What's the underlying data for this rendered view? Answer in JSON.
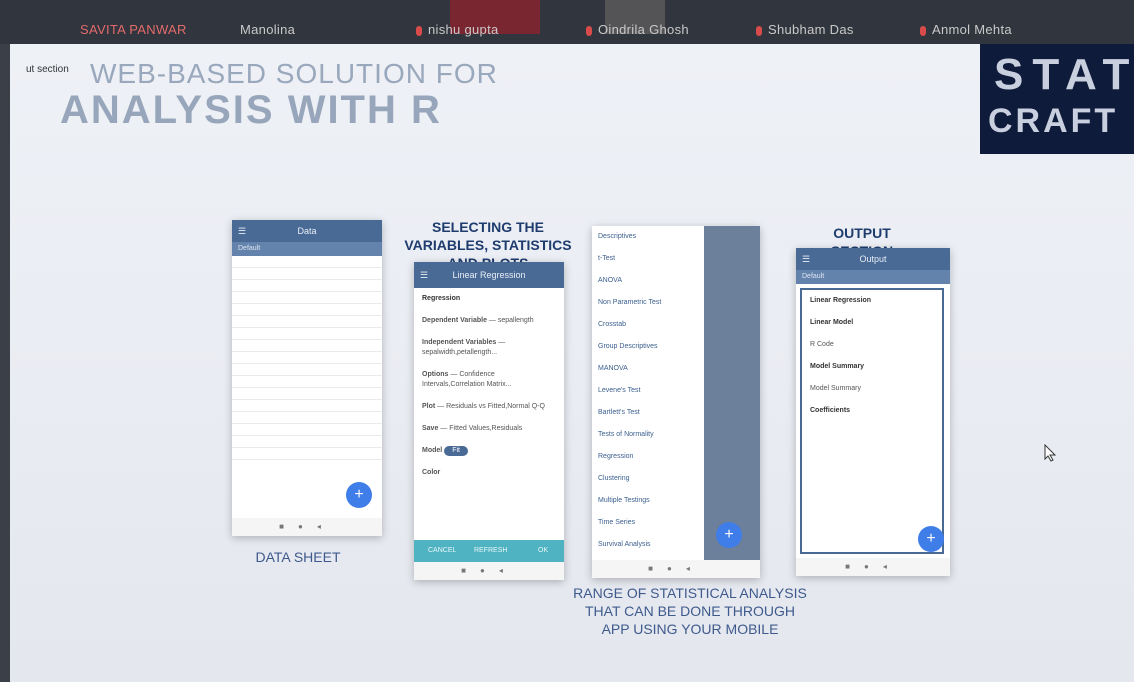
{
  "meeting": {
    "participants": [
      "SAVITA PANWAR",
      "Manolina",
      "nishu gupta",
      "Oindrila Ghosh",
      "Shubham Das",
      "Anmol Mehta"
    ]
  },
  "slide": {
    "overlay_tip": "ut section",
    "title_line1": "WEB-BASED SOLUTION FOR",
    "title_line2": "ANALYSIS WITH R",
    "logo_line1": "STAT",
    "logo_line2": "CRAFT",
    "captions": {
      "selecting": "SELECTING THE VARIABLES, STATISTICS AND PLOTS",
      "output": "OUTPUT SECTION",
      "datasheet": "DATA SHEET",
      "range": "RANGE OF STATISTICAL ANALYSIS THAT CAN BE DONE THROUGH APP USING YOUR MOBILE"
    }
  },
  "phones": {
    "data": {
      "title": "Data",
      "sub": "Default"
    },
    "regression": {
      "title": "Linear Regression",
      "section": "Regression",
      "rows": [
        {
          "k": "Dependent Variable",
          "v": "sepallength"
        },
        {
          "k": "Independent Variables",
          "v": "sepalwidth,petallength..."
        },
        {
          "k": "Options",
          "v": "Confidence Intervals,Correlation Matrix..."
        },
        {
          "k": "Plot",
          "v": "Residuals vs Fitted,Normal Q-Q"
        },
        {
          "k": "Save",
          "v": "Fitted Values,Residuals"
        },
        {
          "k": "Model",
          "v": "Fit"
        },
        {
          "k": "Color",
          "v": ""
        }
      ],
      "footer": [
        "CANCEL",
        "REFRESH",
        "OK"
      ]
    },
    "menu": {
      "items": [
        "Descriptives",
        "t-Test",
        "ANOVA",
        "Non Parametric Test",
        "Crosstab",
        "Group Descriptives",
        "MANOVA",
        "Levene's Test",
        "Bartlett's Test",
        "Tests of Normality",
        "Regression",
        "Clustering",
        "Multiple Testings",
        "Time Series",
        "Survival Analysis"
      ]
    },
    "output": {
      "title": "Output",
      "sub": "Default",
      "lines": [
        "Linear Regression",
        "Linear Model",
        "R Code",
        "Model Summary",
        "Model Summary",
        "Coefficients"
      ]
    }
  }
}
